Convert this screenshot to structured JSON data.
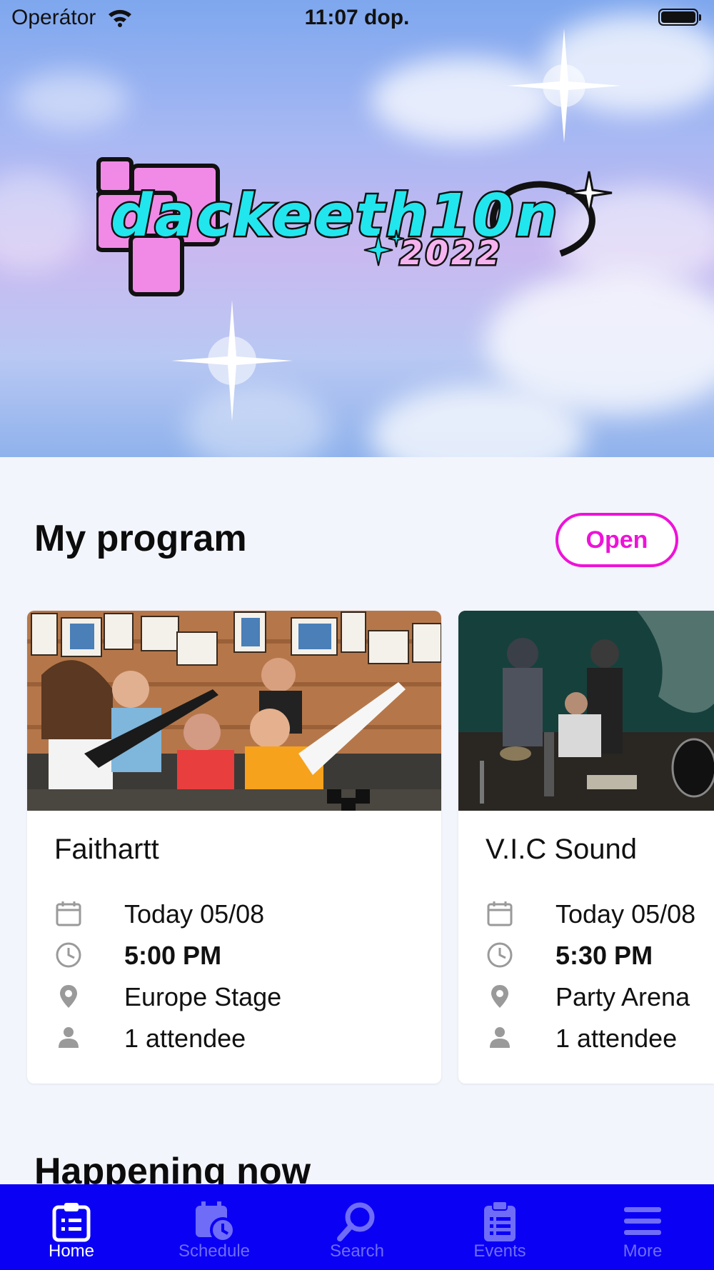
{
  "status_bar": {
    "carrier": "Operátor",
    "time": "11:07 dop."
  },
  "logo": {
    "title": "dackeeth10n",
    "year": "2022"
  },
  "my_program": {
    "title": "My program",
    "open_label": "Open",
    "cards": [
      {
        "name": "Faithartt",
        "date": "Today 05/08",
        "time": "5:00 PM",
        "location": "Europe Stage",
        "attendees": "1 attendee"
      },
      {
        "name": "V.I.C Sound",
        "date": "Today 05/08",
        "time": "5:30 PM",
        "location": "Party Arena",
        "attendees": "1 attendee"
      }
    ]
  },
  "happening_now": {
    "title": "Happening now"
  },
  "tab_bar": {
    "tabs": [
      {
        "label": "Home",
        "icon": "clipboard-list-icon",
        "active": true
      },
      {
        "label": "Schedule",
        "icon": "calendar-clock-icon",
        "active": false
      },
      {
        "label": "Search",
        "icon": "search-icon",
        "active": false
      },
      {
        "label": "Events",
        "icon": "clipboard-icon",
        "active": false
      },
      {
        "label": "More",
        "icon": "menu-icon",
        "active": false
      }
    ]
  },
  "colors": {
    "accent": "#ee12d8",
    "tab_bar": "#0a00f4",
    "tab_inactive": "#6f6cf7",
    "background": "#f3f5fc"
  }
}
